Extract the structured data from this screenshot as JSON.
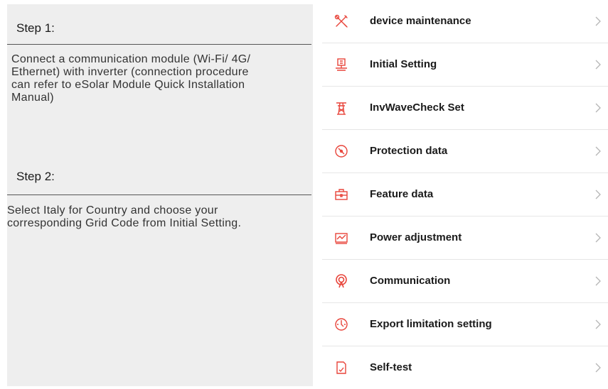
{
  "instructions": {
    "step1": {
      "title": "Step 1:",
      "lines": [
        "Connect a communication module (Wi-Fi/ 4G/",
        "Ethernet) with inverter (connection procedure",
        "can refer to eSolar Module Quick Installation",
        "Manual)"
      ]
    },
    "step2": {
      "title": "Step 2:",
      "lines": [
        "Select Italy for Country and choose your",
        "corresponding Grid Code from Initial Setting."
      ]
    }
  },
  "menu": {
    "accent_color": "#e8443a",
    "items": [
      {
        "label": "device maintenance",
        "icon": "tools-icon"
      },
      {
        "label": "Initial Setting",
        "icon": "inverter-setting-icon"
      },
      {
        "label": "InvWaveCheck Set",
        "icon": "transmission-tower-icon"
      },
      {
        "label": "Protection data",
        "icon": "protection-gauge-icon"
      },
      {
        "label": "Feature data",
        "icon": "briefcase-icon"
      },
      {
        "label": "Power adjustment",
        "icon": "power-chart-icon"
      },
      {
        "label": "Communication",
        "icon": "signal-antenna-icon"
      },
      {
        "label": "Export limitation setting",
        "icon": "export-gauge-icon"
      },
      {
        "label": "Self-test",
        "icon": "self-test-document-icon"
      }
    ]
  }
}
